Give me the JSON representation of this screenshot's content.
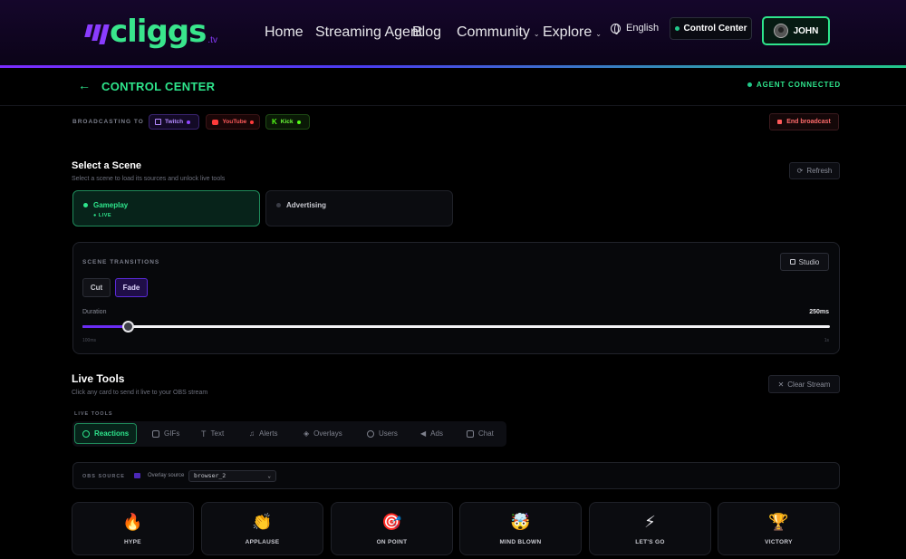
{
  "brand": {
    "name": "cliggs",
    "suffix": ".tv",
    "accent": "#2ee58c",
    "secondary": "#8a3cff"
  },
  "nav": {
    "links": [
      {
        "label": "Home"
      },
      {
        "label": "Streaming Agent"
      },
      {
        "label": "Blog"
      },
      {
        "label": "Community"
      },
      {
        "label": "Explore"
      }
    ],
    "language": "English",
    "control_center": "Control Center",
    "user": "JOHN"
  },
  "header": {
    "title": "CONTROL CENTER",
    "status": "AGENT CONNECTED"
  },
  "broadcast": {
    "label": "BROADCASTING TO",
    "platforms": [
      {
        "name": "Twitch",
        "color": "#9146ff"
      },
      {
        "name": "YouTube",
        "color": "#ff3b3b"
      },
      {
        "name": "Kick",
        "color": "#53fc18"
      }
    ],
    "end_label": "End broadcast"
  },
  "scenes": {
    "title": "Select a Scene",
    "subtitle": "Select a scene to load its sources and unlock live tools",
    "refresh": "Refresh",
    "items": [
      {
        "name": "Gameplay",
        "badge": "● LIVE",
        "active": true
      },
      {
        "name": "Advertising",
        "badge": "",
        "active": false
      }
    ]
  },
  "transitions": {
    "label": "SCENE TRANSITIONS",
    "studio": "Studio",
    "cut": "Cut",
    "fade": "Fade",
    "duration_label": "Duration",
    "duration_value": "250ms",
    "min": "100ms",
    "max": "1s",
    "position": 0.06
  },
  "live_tools": {
    "title": "Live Tools",
    "subtitle": "Click any card to send it live to your OBS stream",
    "clear": "Clear Stream",
    "tabs_label": "LIVE TOOLS",
    "tabs": [
      "Reactions",
      "GIFs",
      "Text",
      "Alerts",
      "Overlays",
      "Users",
      "Ads",
      "Chat"
    ],
    "obs_label": "OBS SOURCE",
    "overlay_label": "Overlay source",
    "overlay_value": "browser_2",
    "cards": [
      {
        "emoji": "🔥",
        "label": "HYPE"
      },
      {
        "emoji": "👏",
        "label": "APPLAUSE"
      },
      {
        "emoji": "🎯",
        "label": "ON POINT"
      },
      {
        "emoji": "🤯",
        "label": "MIND BLOWN"
      },
      {
        "emoji": "⚡",
        "label": "LET'S GO"
      },
      {
        "emoji": "🏆",
        "label": "VICTORY"
      }
    ]
  }
}
